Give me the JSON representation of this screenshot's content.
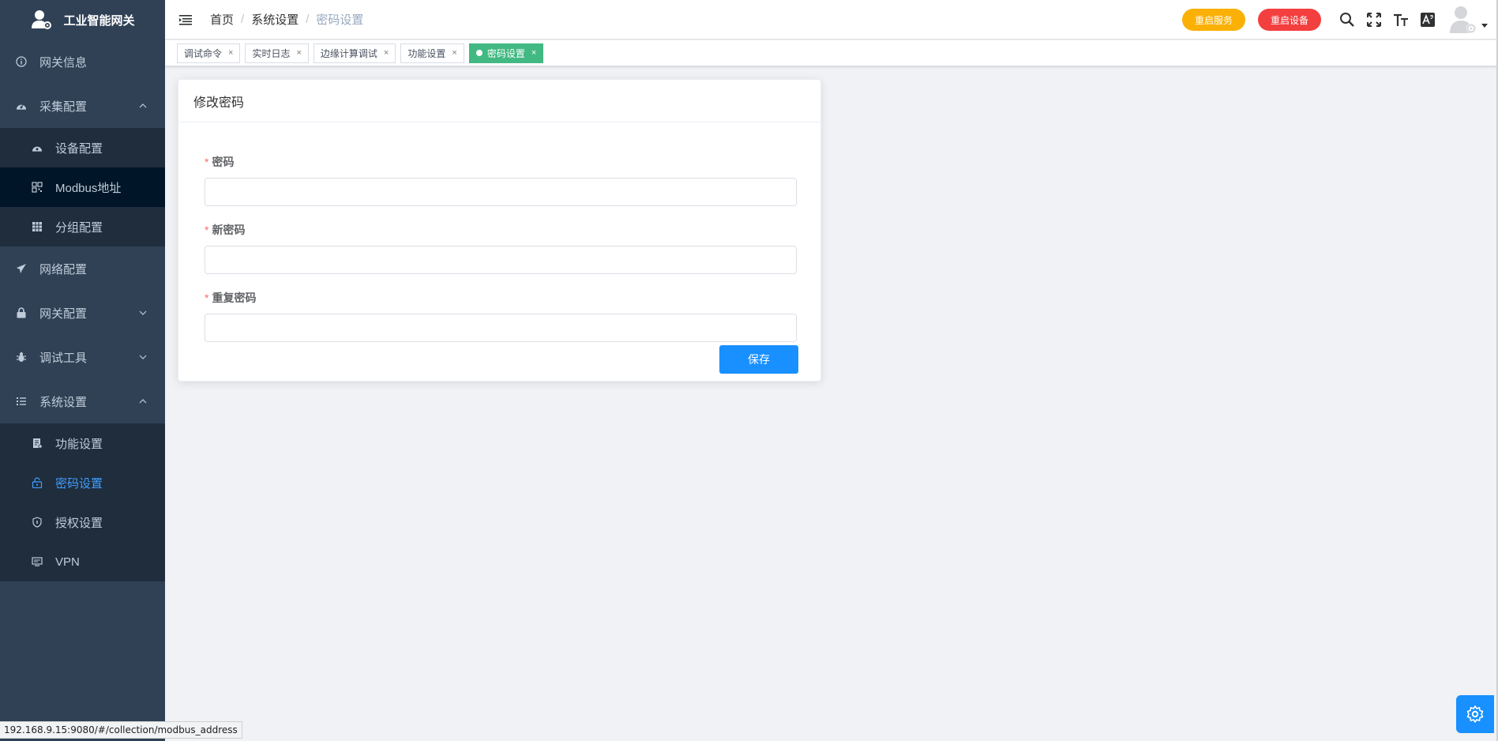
{
  "app": {
    "title": "工业智能网关"
  },
  "sidebar": {
    "items": [
      {
        "label": "网关信息",
        "icon": "info-icon"
      },
      {
        "label": "采集配置",
        "icon": "dashboard-icon",
        "expanded": true,
        "children": [
          {
            "label": "设备配置",
            "icon": "dashboard-icon"
          },
          {
            "label": "Modbus地址",
            "icon": "qrcode-icon"
          },
          {
            "label": "分组配置",
            "icon": "table-icon"
          }
        ]
      },
      {
        "label": "网络配置",
        "icon": "send-icon"
      },
      {
        "label": "网关配置",
        "icon": "lock-icon",
        "expanded": false
      },
      {
        "label": "调试工具",
        "icon": "bug-icon",
        "expanded": false
      },
      {
        "label": "系统设置",
        "icon": "list-icon",
        "expanded": true,
        "children": [
          {
            "label": "功能设置",
            "icon": "document-icon"
          },
          {
            "label": "密码设置",
            "icon": "unlock-icon",
            "active": true
          },
          {
            "label": "授权设置",
            "icon": "shield-icon"
          },
          {
            "label": "VPN",
            "icon": "monitor-icon"
          }
        ]
      }
    ]
  },
  "breadcrumb": [
    "首页",
    "系统设置",
    "密码设置"
  ],
  "header": {
    "restart_service": "重启服务",
    "restart_device": "重启设备",
    "colors": {
      "orange": "#fab005",
      "red": "#f43f3f"
    }
  },
  "tags": [
    {
      "label": "调试命令"
    },
    {
      "label": "实时日志"
    },
    {
      "label": "边缘计算调试"
    },
    {
      "label": "功能设置"
    },
    {
      "label": "密码设置",
      "active": true
    }
  ],
  "card": {
    "title": "修改密码",
    "fields": [
      {
        "label": "密码",
        "value": ""
      },
      {
        "label": "新密码",
        "value": ""
      },
      {
        "label": "重复密码",
        "value": ""
      }
    ],
    "save_label": "保存"
  },
  "status_url": "192.168.9.15:9080/#/collection/modbus_address",
  "theme": {
    "sidebar_bg": "#304156",
    "accent": "#409eff",
    "tag_active": "#42b983",
    "primary_button": "#1890ff"
  }
}
